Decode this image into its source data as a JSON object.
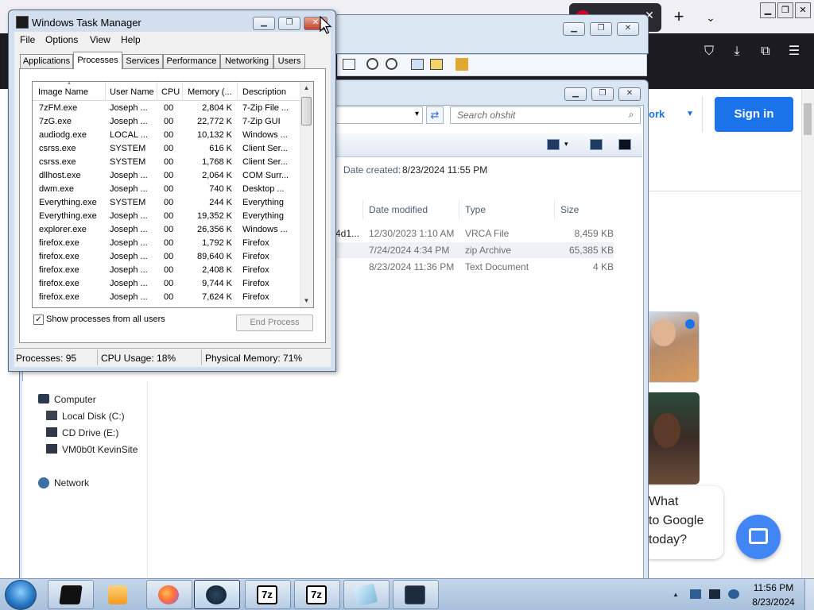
{
  "firefox": {
    "tab_close": "✕",
    "new_tab": "+",
    "list_tabs": "⌄",
    "window_buttons": {
      "minimize": "▁",
      "restore": "❐",
      "close": "✕"
    },
    "toolbar_icons": [
      "pocket-icon",
      "download-icon",
      "extensions-icon",
      "menu-icon"
    ],
    "toolbar_glyphs": {
      "pocket": "⛉",
      "download": "⤓",
      "extensions": "⧉",
      "menu": "☰"
    },
    "page": {
      "sign_in": "Sign in",
      "work_link": "ork",
      "work_dropdown": "▼",
      "chat_prompt_lines": [
        "What",
        "to Google",
        "today?"
      ]
    },
    "colors": {
      "accent": "#1a73e8",
      "fab": "#4285f4",
      "toolbar": "#1c1b22"
    }
  },
  "explorer": {
    "search_placeholder": "Search ohshit",
    "search_icon": "⌕",
    "address_dropdown": "▾",
    "refresh": "⇄",
    "date_created_label": "Date created:",
    "date_created_value": "8/23/2024 11:55 PM",
    "columns": [
      "Date modified",
      "Type",
      "Size"
    ],
    "files": [
      {
        "name_fragment": "4d1...",
        "date": "12/30/2023 1:10 AM",
        "type": "VRCA File",
        "size": "8,459 KB"
      },
      {
        "name_fragment": "",
        "date": "7/24/2024 4:34 PM",
        "type": "zip Archive",
        "size": "65,385 KB"
      },
      {
        "name_fragment": "",
        "date": "8/23/2024 11:36 PM",
        "type": "Text Document",
        "size": "4 KB"
      }
    ],
    "nav": {
      "computer": "Computer",
      "drives": [
        "Local Disk (C:)",
        "CD Drive (E:)",
        "VM0b0t KevinSite"
      ],
      "network": "Network"
    }
  },
  "task_manager": {
    "title": "Windows Task Manager",
    "menu": [
      "File",
      "Options",
      "View",
      "Help"
    ],
    "tabs": [
      "Applications",
      "Processes",
      "Services",
      "Performance",
      "Networking",
      "Users"
    ],
    "active_tab": "Processes",
    "columns": [
      "Image Name",
      "User Name",
      "CPU",
      "Memory (...",
      "Description"
    ],
    "processes": [
      {
        "image": "7zFM.exe",
        "user": "Joseph ...",
        "cpu": "00",
        "mem": "2,804 K",
        "desc": "7-Zip File ..."
      },
      {
        "image": "7zG.exe",
        "user": "Joseph ...",
        "cpu": "00",
        "mem": "22,772 K",
        "desc": "7-Zip GUI"
      },
      {
        "image": "audiodg.exe",
        "user": "LOCAL ...",
        "cpu": "00",
        "mem": "10,132 K",
        "desc": "Windows ..."
      },
      {
        "image": "csrss.exe",
        "user": "SYSTEM",
        "cpu": "00",
        "mem": "616 K",
        "desc": "Client Ser..."
      },
      {
        "image": "csrss.exe",
        "user": "SYSTEM",
        "cpu": "00",
        "mem": "1,768 K",
        "desc": "Client Ser..."
      },
      {
        "image": "dllhost.exe",
        "user": "Joseph ...",
        "cpu": "00",
        "mem": "2,064 K",
        "desc": "COM Surr..."
      },
      {
        "image": "dwm.exe",
        "user": "Joseph ...",
        "cpu": "00",
        "mem": "740 K",
        "desc": "Desktop ..."
      },
      {
        "image": "Everything.exe",
        "user": "SYSTEM",
        "cpu": "00",
        "mem": "244 K",
        "desc": "Everything"
      },
      {
        "image": "Everything.exe",
        "user": "Joseph ...",
        "cpu": "00",
        "mem": "19,352 K",
        "desc": "Everything"
      },
      {
        "image": "explorer.exe",
        "user": "Joseph ...",
        "cpu": "00",
        "mem": "26,356 K",
        "desc": "Windows ..."
      },
      {
        "image": "firefox.exe",
        "user": "Joseph ...",
        "cpu": "00",
        "mem": "1,792 K",
        "desc": "Firefox"
      },
      {
        "image": "firefox.exe",
        "user": "Joseph ...",
        "cpu": "00",
        "mem": "89,640 K",
        "desc": "Firefox"
      },
      {
        "image": "firefox.exe",
        "user": "Joseph ...",
        "cpu": "00",
        "mem": "2,408 K",
        "desc": "Firefox"
      },
      {
        "image": "firefox.exe",
        "user": "Joseph ...",
        "cpu": "00",
        "mem": "9,744 K",
        "desc": "Firefox"
      },
      {
        "image": "firefox.exe",
        "user": "Joseph ...",
        "cpu": "00",
        "mem": "7,624 K",
        "desc": "Firefox"
      }
    ],
    "show_all_label": "Show processes from all users",
    "show_all_checked": "✓",
    "end_process": "End Process",
    "status": {
      "processes": "Processes: 95",
      "cpu": "CPU Usage: 18%",
      "memory": "Physical Memory: 71%"
    },
    "window_buttons": {
      "minimize": "▁",
      "restore": "❐",
      "close": "✕"
    },
    "scroll_up": "▲",
    "scroll_down": "▼",
    "sort_indicator": "▲"
  },
  "taskbar": {
    "apps": [
      "terminal-icon",
      "media-player-icon",
      "firefox-icon",
      "steam-icon",
      "7zip-fm-icon",
      "7zip-gui-icon",
      "notepad-icon",
      "task-manager-icon"
    ],
    "seven_zip_label": "7z",
    "tray_arrow": "▲",
    "time": "11:56 PM",
    "date": "8/23/2024"
  }
}
